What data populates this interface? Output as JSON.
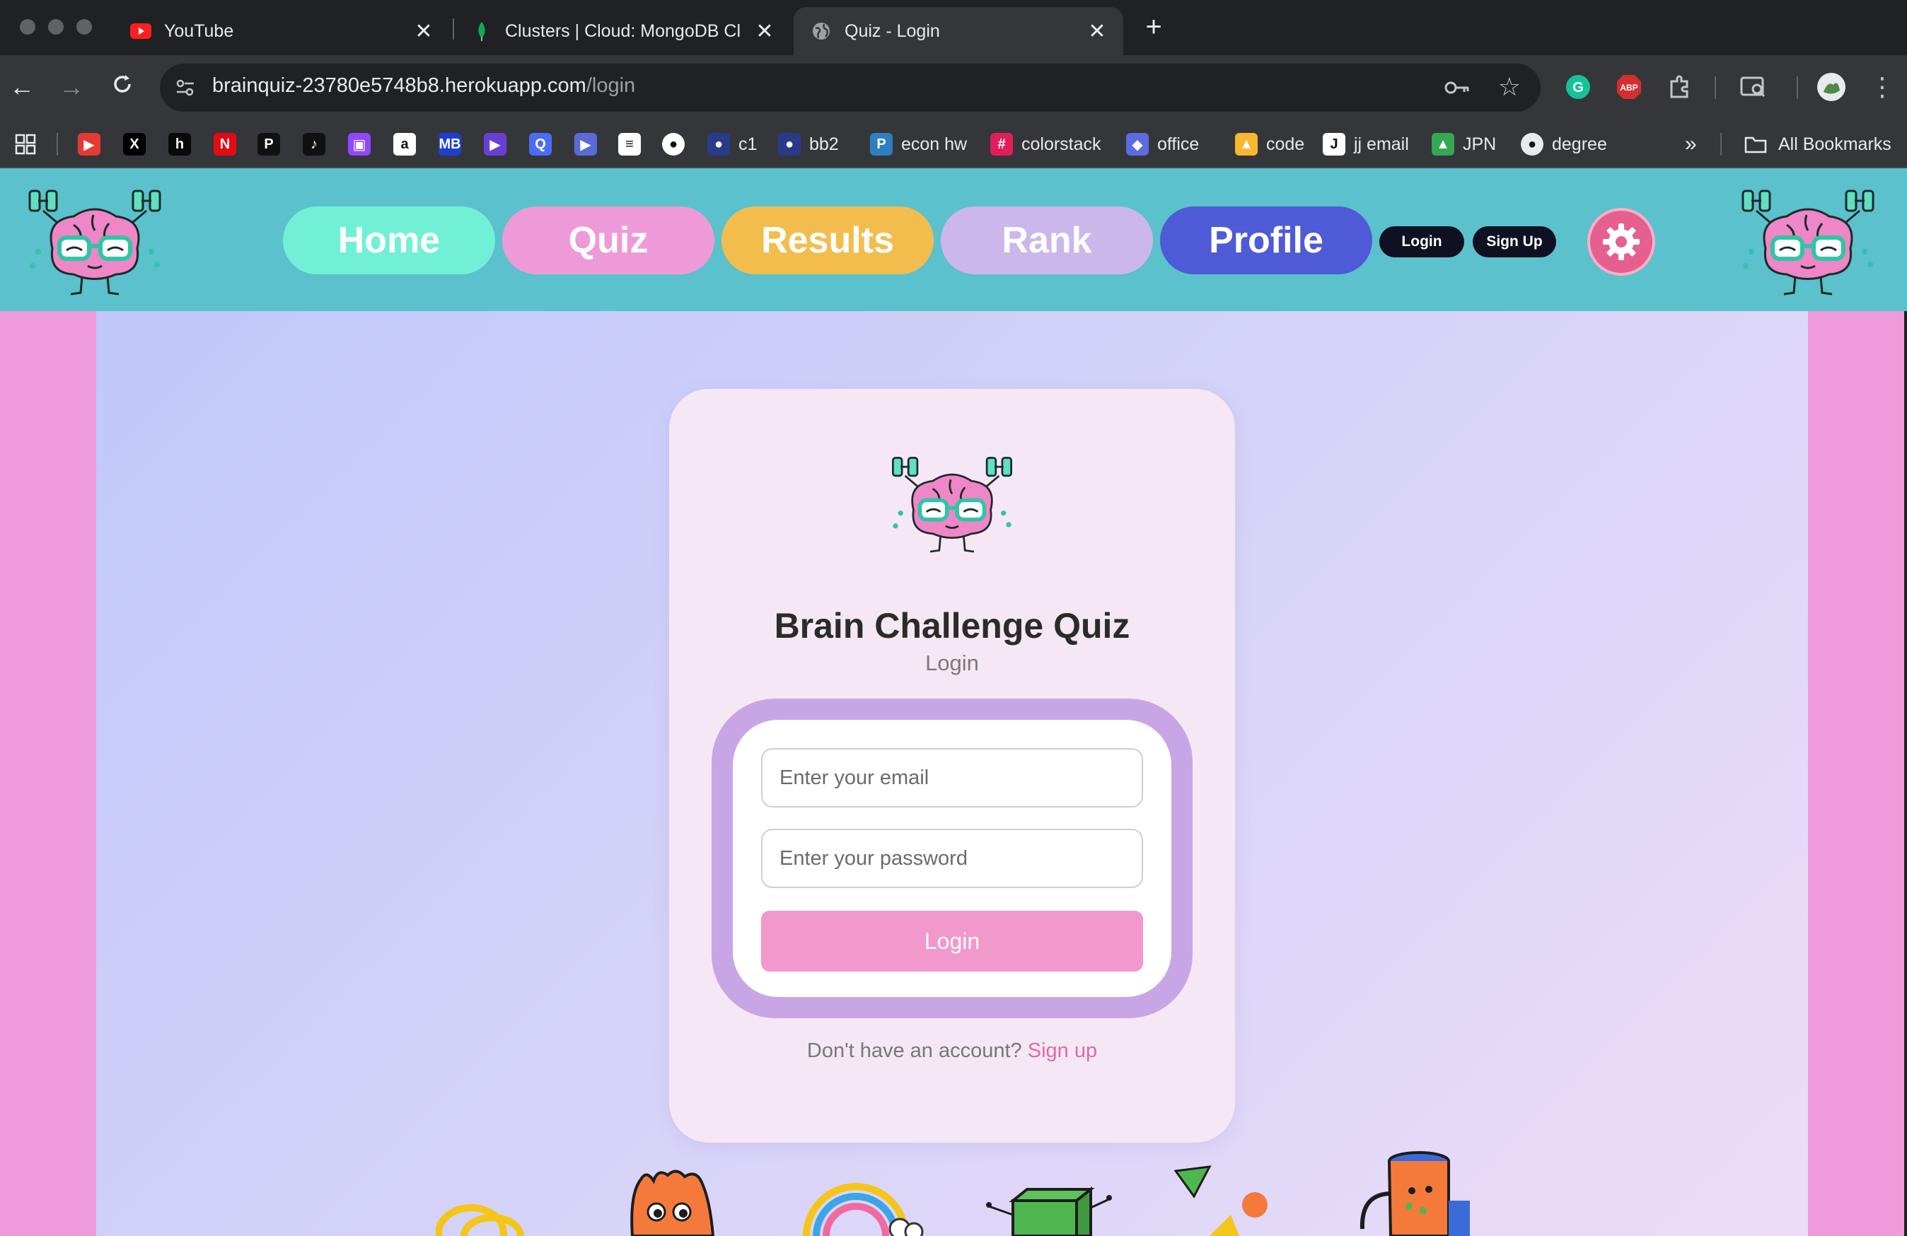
{
  "browser": {
    "tabs": [
      {
        "title": "YouTube",
        "favicon": "youtube-icon"
      },
      {
        "title": "Clusters | Cloud: MongoDB Cl",
        "favicon": "mongodb-leaf-icon"
      },
      {
        "title": "Quiz - Login",
        "favicon": "globe-icon"
      }
    ],
    "url_host": "brainquiz-23780e5748b8.herokuapp.com",
    "url_path": "/login",
    "bookmarks": [
      {
        "label": "",
        "icon": "youtube-icon",
        "color": "#e53935"
      },
      {
        "label": "",
        "icon": "x-icon",
        "color": "#000000"
      },
      {
        "label": "",
        "icon": "h-icon",
        "color": "#0a0a0a"
      },
      {
        "label": "",
        "icon": "netflix-icon",
        "color": "#e50914"
      },
      {
        "label": "",
        "icon": "p-icon",
        "color": "#111111"
      },
      {
        "label": "",
        "icon": "tiktok-icon",
        "color": "#111111"
      },
      {
        "label": "",
        "icon": "twitch-icon",
        "color": "#9146ff"
      },
      {
        "label": "",
        "icon": "amazon-icon",
        "color": "#ffffff"
      },
      {
        "label": "",
        "icon": "mb-icon",
        "color": "#1d3fcf"
      },
      {
        "label": "",
        "icon": "play-icon",
        "color": "#6b3fd6"
      },
      {
        "label": "",
        "icon": "q-icon",
        "color": "#4a6cf7"
      },
      {
        "label": "",
        "icon": "video-icon",
        "color": "#5a6bd8"
      },
      {
        "label": "",
        "icon": "doc-icon",
        "color": "#ffffff"
      },
      {
        "label": "",
        "icon": "github-icon",
        "color": "#ffffff"
      },
      {
        "label": "c1",
        "icon": "c1-icon",
        "color": "#2a3a8a"
      },
      {
        "label": "bb2",
        "icon": "bb-icon",
        "color": "#2a3a8a"
      },
      {
        "label": "econ hw",
        "icon": "p-circle-icon",
        "color": "#2e7fbf"
      },
      {
        "label": "colorstack",
        "icon": "slack-icon",
        "color": "#e01e5a"
      },
      {
        "label": "office",
        "icon": "office-icon",
        "color": "#5b6be0"
      },
      {
        "label": "code",
        "icon": "rocket-icon",
        "color": "#f7b731"
      },
      {
        "label": "jj email",
        "icon": "jj-icon",
        "color": "#ffffff"
      },
      {
        "label": "JPN",
        "icon": "drive-icon",
        "color": "#34a853"
      },
      {
        "label": "degree",
        "icon": "globe-icon",
        "color": "#e8eaed"
      }
    ],
    "all_bookmarks": "All Bookmarks"
  },
  "site": {
    "nav": [
      {
        "label": "Home",
        "color": "#72f0d6"
      },
      {
        "label": "Quiz",
        "color": "#ef9ad8"
      },
      {
        "label": "Results",
        "color": "#f3bd4e"
      },
      {
        "label": "Rank",
        "color": "#cbb7ea"
      },
      {
        "label": "Profile",
        "color": "#4f5ad6"
      }
    ],
    "login_btn": "Login",
    "signup_btn": "Sign Up"
  },
  "card": {
    "title": "Brain Challenge Quiz",
    "subtitle": "Login",
    "email_placeholder": "Enter your email",
    "password_placeholder": "Enter your password",
    "submit": "Login",
    "no_account": "Don't have an account?",
    "signup_link": "Sign up"
  }
}
